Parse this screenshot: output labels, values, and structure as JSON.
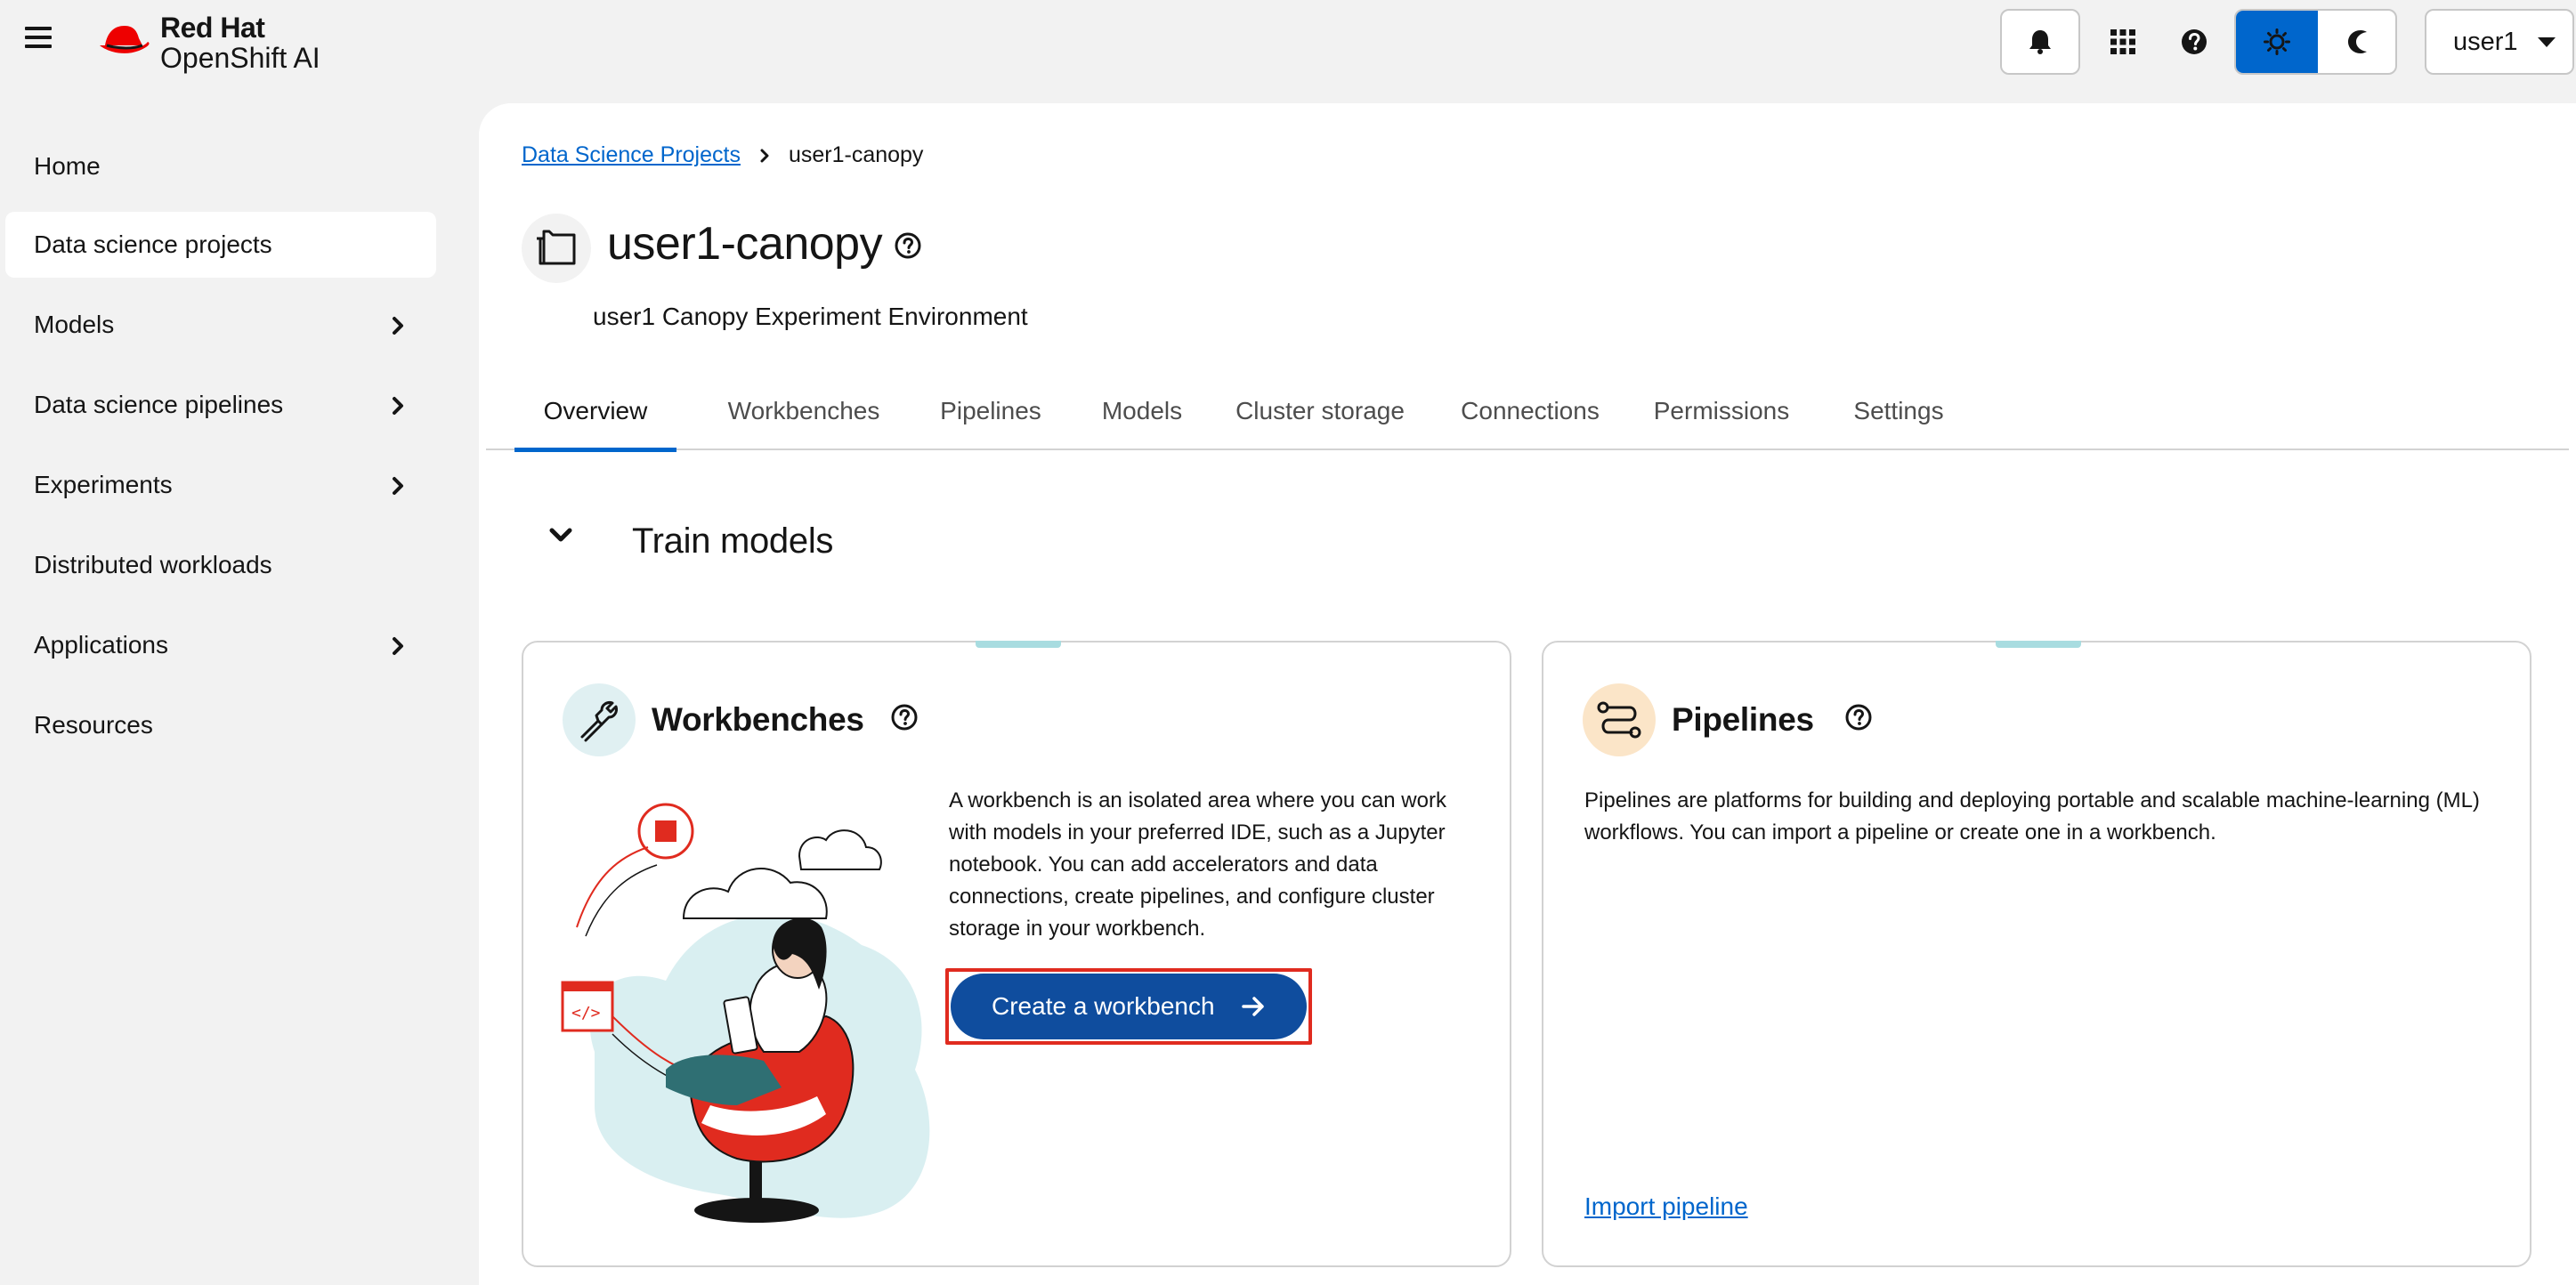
{
  "masthead": {
    "brand_line1": "Red Hat",
    "brand_line2": "OpenShift AI",
    "icons": [
      "hamburger-icon",
      "bell-icon",
      "app-grid-icon",
      "help-icon",
      "sun-icon",
      "moon-icon"
    ],
    "user_label": "user1"
  },
  "sidebar": {
    "items": [
      {
        "label": "Home",
        "expandable": false,
        "active": false
      },
      {
        "label": "Data science projects",
        "expandable": false,
        "active": true
      },
      {
        "label": "Models",
        "expandable": true,
        "active": false
      },
      {
        "label": "Data science pipelines",
        "expandable": true,
        "active": false
      },
      {
        "label": "Experiments",
        "expandable": true,
        "active": false
      },
      {
        "label": "Distributed workloads",
        "expandable": false,
        "active": false
      },
      {
        "label": "Applications",
        "expandable": true,
        "active": false
      },
      {
        "label": "Resources",
        "expandable": false,
        "active": false
      }
    ]
  },
  "breadcrumb": {
    "parent": "Data Science Projects",
    "current": "user1-canopy"
  },
  "project": {
    "title": "user1-canopy",
    "description": "user1 Canopy Experiment Environment"
  },
  "tabs": [
    {
      "label": "Overview",
      "active": true
    },
    {
      "label": "Workbenches",
      "active": false
    },
    {
      "label": "Pipelines",
      "active": false
    },
    {
      "label": "Models",
      "active": false
    },
    {
      "label": "Cluster storage",
      "active": false
    },
    {
      "label": "Connections",
      "active": false
    },
    {
      "label": "Permissions",
      "active": false
    },
    {
      "label": "Settings",
      "active": false
    }
  ],
  "section": {
    "title": "Train models"
  },
  "workbenches_card": {
    "title": "Workbenches",
    "description": "A workbench is an isolated area where you can work with models in your preferred IDE, such as a Jupyter notebook. You can add accelerators and data connections, create pipelines, and configure cluster storage in your workbench.",
    "button_label": "Create a workbench"
  },
  "pipelines_card": {
    "title": "Pipelines",
    "description": "Pipelines are platforms for building and deploying portable and scalable machine-learning (ML) workflows. You can import a pipeline or create one in a workbench.",
    "link_label": "Import pipeline"
  },
  "colors": {
    "accent": "#0066cc",
    "primary_button": "#0f4d9e",
    "highlight_outline": "#e02b1f",
    "brand_red": "#ee0000"
  }
}
